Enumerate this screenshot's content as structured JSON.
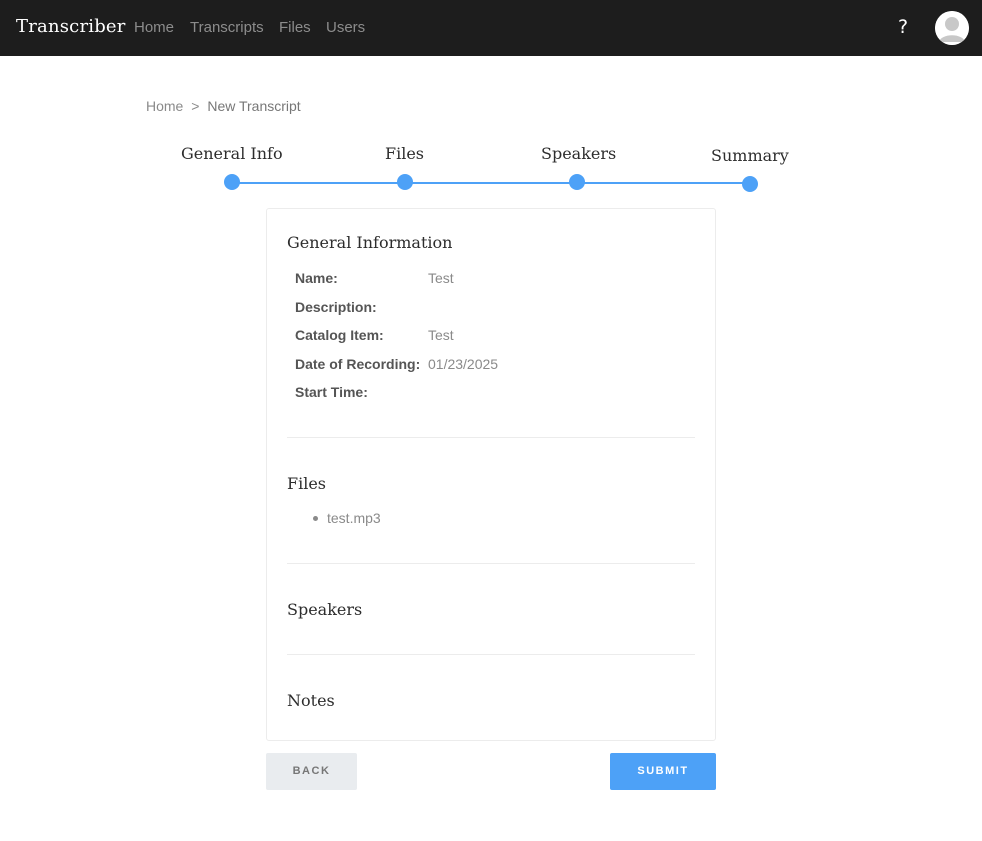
{
  "app": {
    "brand": "Transcriber",
    "nav": [
      "Home",
      "Transcripts",
      "Files",
      "Users"
    ],
    "help_label": "?",
    "avatar_icon": "user-avatar-icon"
  },
  "breadcrumb": {
    "home": "Home",
    "separator": ">",
    "current": "New Transcript"
  },
  "stepper": {
    "accent_color": "#4da1f7",
    "steps": [
      "General Info",
      "Files",
      "Speakers",
      "Summary"
    ]
  },
  "summary": {
    "general": {
      "title": "General Information",
      "fields": [
        {
          "label": "Name:",
          "value": "Test"
        },
        {
          "label": "Description:",
          "value": ""
        },
        {
          "label": "Catalog Item:",
          "value": "Test"
        },
        {
          "label": "Date of Recording:",
          "value": "01/23/2025"
        },
        {
          "label": "Start Time:",
          "value": ""
        }
      ]
    },
    "files": {
      "title": "Files",
      "items": [
        "test.mp3"
      ]
    },
    "speakers": {
      "title": "Speakers"
    },
    "notes": {
      "title": "Notes"
    }
  },
  "actions": {
    "back_label": "BACK",
    "submit_label": "SUBMIT"
  }
}
